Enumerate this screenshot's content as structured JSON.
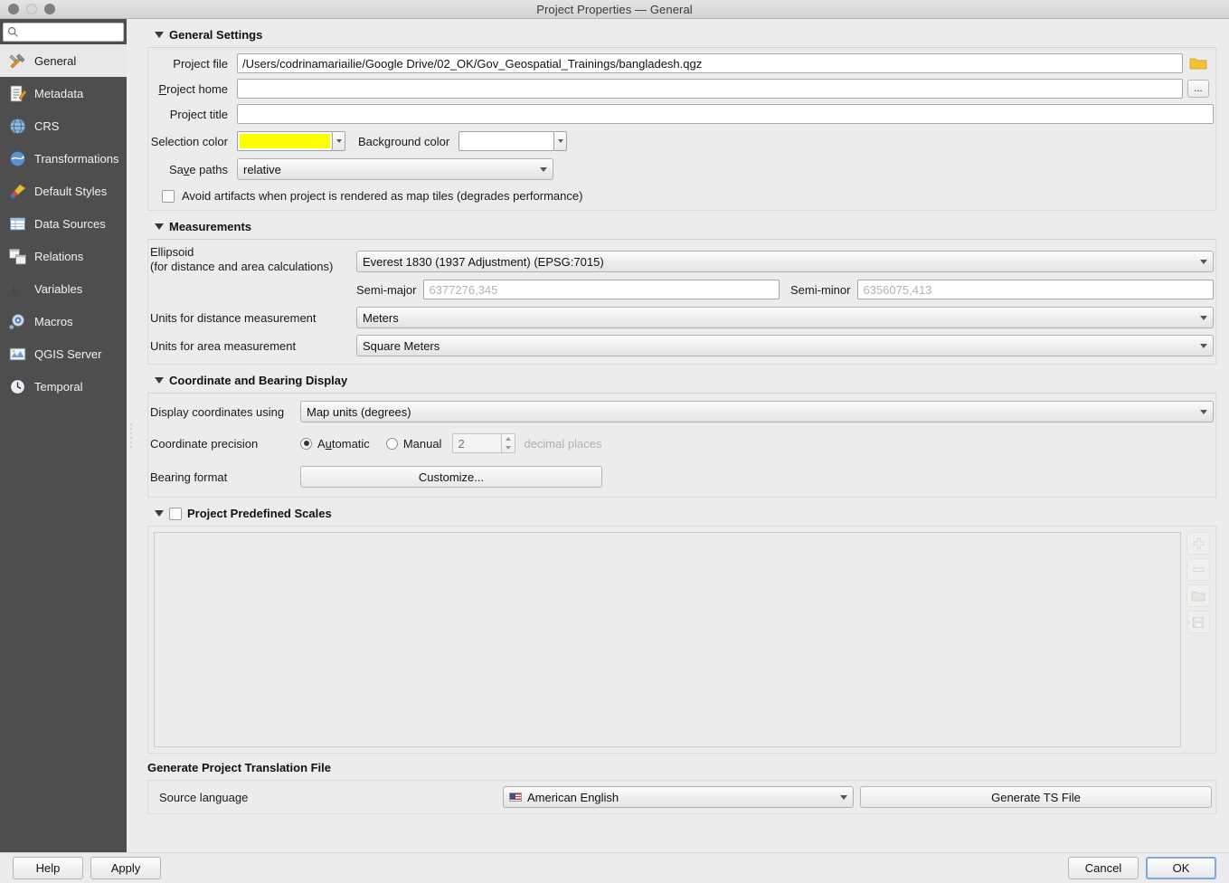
{
  "window": {
    "title": "Project Properties — General",
    "traffic_lights": [
      "close-button",
      "minimize-button",
      "maximize-button"
    ]
  },
  "sidebar": {
    "search": {
      "placeholder": "",
      "value": "",
      "icon": "search-icon"
    },
    "items": [
      {
        "label": "General",
        "icon": "hammer-wrench-icon",
        "active": true
      },
      {
        "label": "Metadata",
        "icon": "document-pencil-icon",
        "active": false
      },
      {
        "label": "CRS",
        "icon": "globe-wire-icon",
        "active": false
      },
      {
        "label": "Transformations",
        "icon": "globe-arrows-icon",
        "active": false
      },
      {
        "label": "Default Styles",
        "icon": "paintbrush-icon",
        "active": false
      },
      {
        "label": "Data Sources",
        "icon": "table-icon",
        "active": false
      },
      {
        "label": "Relations",
        "icon": "two-tables-icon",
        "active": false
      },
      {
        "label": "Variables",
        "icon": "epsilon-icon",
        "active": false
      },
      {
        "label": "Macros",
        "icon": "gear-play-icon",
        "active": false
      },
      {
        "label": "QGIS Server",
        "icon": "server-map-icon",
        "active": false
      },
      {
        "label": "Temporal",
        "icon": "clock-icon",
        "active": false
      }
    ]
  },
  "general_settings": {
    "heading": "General Settings",
    "project_file": {
      "label": "Project file",
      "value": "/Users/codrinamariailie/Google Drive/02_OK/Gov_Geospatial_Trainings/bangladesh.qgz",
      "browse_icon": "folder-icon"
    },
    "project_home": {
      "label": "Project home",
      "value": "",
      "browse_label": "..."
    },
    "project_title": {
      "label": "Project title",
      "value": ""
    },
    "selection_color": {
      "label": "Selection color",
      "value": "#ffff00"
    },
    "background_color": {
      "label": "Background color",
      "value": "#ffffff"
    },
    "save_paths": {
      "label": "Save paths",
      "value": "relative"
    },
    "avoid_artifacts": {
      "label": "Avoid artifacts when project is rendered as map tiles (degrades performance)",
      "checked": false
    }
  },
  "measurements": {
    "heading": "Measurements",
    "ellipsoid": {
      "label_line1": "Ellipsoid",
      "label_line2": "(for distance and area calculations)",
      "value": "Everest 1830 (1937 Adjustment) (EPSG:7015)"
    },
    "semi_major": {
      "label": "Semi-major",
      "value": "6377276,345"
    },
    "semi_minor": {
      "label": "Semi-minor",
      "value": "6356075,413"
    },
    "distance_units": {
      "label": "Units for distance measurement",
      "value": "Meters"
    },
    "area_units": {
      "label": "Units for area measurement",
      "value": "Square Meters"
    }
  },
  "coordinate_display": {
    "heading": "Coordinate and Bearing Display",
    "display_coordinates": {
      "label": "Display coordinates using",
      "value": "Map units (degrees)"
    },
    "coordinate_precision": {
      "label": "Coordinate precision",
      "automatic_label": "Automatic",
      "manual_label": "Manual",
      "selected": "Automatic",
      "decimal_places_value": "2",
      "decimal_places_label": "decimal places"
    },
    "bearing_format": {
      "label": "Bearing format",
      "button_label": "Customize..."
    }
  },
  "predefined_scales": {
    "heading": "Project Predefined Scales",
    "checked": false,
    "items": [],
    "buttons": [
      {
        "name": "add-scale-button",
        "icon": "plus-icon"
      },
      {
        "name": "remove-scale-button",
        "icon": "minus-icon"
      },
      {
        "name": "open-scales-button",
        "icon": "folder-icon"
      },
      {
        "name": "save-scales-button",
        "icon": "save-icon"
      }
    ]
  },
  "translation": {
    "heading": "Generate Project Translation File",
    "source_language": {
      "label": "Source language",
      "value": "American English",
      "flag": "us-flag-icon"
    },
    "generate_button": "Generate TS File"
  },
  "footer": {
    "help": "Help",
    "apply": "Apply",
    "cancel": "Cancel",
    "ok": "OK"
  }
}
